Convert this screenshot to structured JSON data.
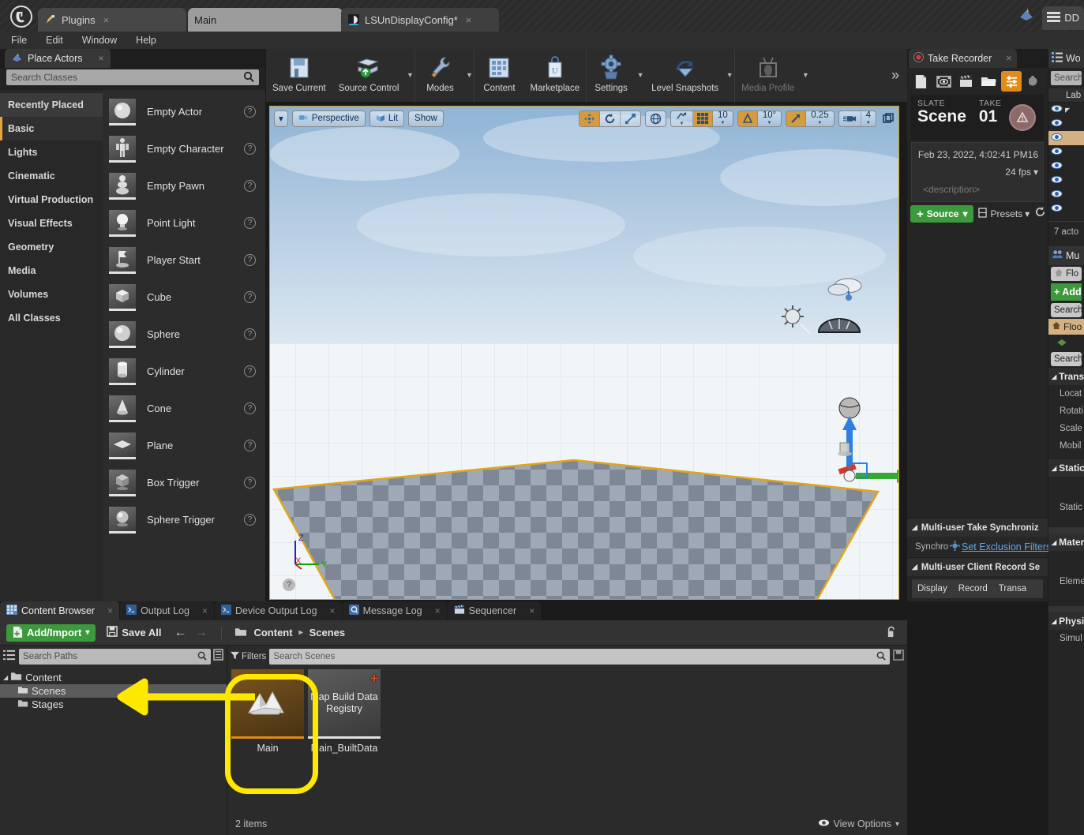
{
  "title_bar": {
    "app_icon": "unreal-logo-icon",
    "tabs": [
      {
        "label": "Plugins",
        "icon": "plug-icon",
        "close": "×"
      },
      {
        "label": "Main",
        "icon": "",
        "close": ""
      },
      {
        "label": "LSUnDisplayConfig*",
        "icon": "ndisplay-icon",
        "close": "×"
      }
    ],
    "right_tab_label": "DD"
  },
  "menu_bar": {
    "items": [
      "File",
      "Edit",
      "Window",
      "Help"
    ]
  },
  "place_actors": {
    "tab_label": "Place Actors",
    "tab_icon": "place-actors-icon",
    "close": "×",
    "search_placeholder": "Search Classes",
    "search_icon": "search-icon",
    "categories": [
      {
        "label": "Recently Placed",
        "state": "hover"
      },
      {
        "label": "Basic",
        "state": "selected"
      },
      {
        "label": "Lights",
        "state": "normal"
      },
      {
        "label": "Cinematic",
        "state": "normal"
      },
      {
        "label": "Virtual Production",
        "state": "normal"
      },
      {
        "label": "Visual Effects",
        "state": "normal"
      },
      {
        "label": "Geometry",
        "state": "normal"
      },
      {
        "label": "Media",
        "state": "normal"
      },
      {
        "label": "Volumes",
        "state": "normal"
      },
      {
        "label": "All Classes",
        "state": "normal"
      }
    ],
    "items": [
      {
        "label": "Empty Actor",
        "icon": "sphere-thumb-icon",
        "help": "?"
      },
      {
        "label": "Empty Character",
        "icon": "character-thumb-icon",
        "help": "?"
      },
      {
        "label": "Empty Pawn",
        "icon": "pawn-thumb-icon",
        "help": "?"
      },
      {
        "label": "Point Light",
        "icon": "bulb-thumb-icon",
        "help": "?"
      },
      {
        "label": "Player Start",
        "icon": "flag-thumb-icon",
        "help": "?"
      },
      {
        "label": "Cube",
        "icon": "cube-thumb-icon",
        "help": "?"
      },
      {
        "label": "Sphere",
        "icon": "sphere-thumb-icon",
        "help": "?"
      },
      {
        "label": "Cylinder",
        "icon": "cylinder-thumb-icon",
        "help": "?"
      },
      {
        "label": "Cone",
        "icon": "cone-thumb-icon",
        "help": "?"
      },
      {
        "label": "Plane",
        "icon": "plane-thumb-icon",
        "help": "?"
      },
      {
        "label": "Box Trigger",
        "icon": "box-trigger-thumb-icon",
        "help": "?"
      },
      {
        "label": "Sphere Trigger",
        "icon": "sphere-trigger-thumb-icon",
        "help": "?"
      }
    ]
  },
  "main_toolbar": {
    "tools": [
      {
        "label": "Save Current",
        "icon": "floppy-disk-icon",
        "caret": false,
        "dim": false
      },
      {
        "label": "Source Control",
        "icon": "source-control-icon",
        "caret": true,
        "dim": false
      },
      {
        "label": "Modes",
        "icon": "wrench-pencil-icon",
        "caret": true,
        "dim": false
      },
      {
        "label": "Content",
        "icon": "content-grid-icon",
        "caret": false,
        "dim": false
      },
      {
        "label": "Marketplace",
        "icon": "marketplace-bag-icon",
        "caret": false,
        "dim": false
      },
      {
        "label": "Settings",
        "icon": "gear-icon",
        "caret": true,
        "dim": false
      },
      {
        "label": "Level Snapshots",
        "icon": "level-snapshots-icon",
        "caret": true,
        "dim": false
      },
      {
        "label": "Media Profile",
        "icon": "media-profile-icon",
        "caret": true,
        "dim": true
      }
    ],
    "overflow": "»"
  },
  "viewport": {
    "dropdown_caret": "▾",
    "view_mode": "Perspective",
    "view_mode_icon": "camera-icon",
    "lighting_mode": "Lit",
    "lighting_icon": "lit-cube-icon",
    "show_menu": "Show",
    "transform_tools": [
      {
        "icon": "translate-gizmo-icon",
        "active": true
      },
      {
        "icon": "rotate-gizmo-icon",
        "active": false
      },
      {
        "icon": "scale-gizmo-icon",
        "active": false
      }
    ],
    "coordinate_system_icon": "world-globe-icon",
    "surface_snap_icon": "surface-snap-icon",
    "grid_snap_icon": "grid-snap-icon",
    "grid_snap_value": "10",
    "angle_snap_icon": "angle-snap-icon",
    "angle_snap_value": "10°",
    "scale_snap_icon": "scale-snap-icon",
    "scale_snap_value": "0.25",
    "camera_speed_icon": "camera-speed-icon",
    "camera_speed_value": "4",
    "maximize_icon": "maximize-viewport-icon",
    "axes": {
      "z": "Z",
      "x": "X",
      "y": "Y"
    },
    "help_icon": "?"
  },
  "take_recorder": {
    "tab_label": "Take Recorder",
    "tab_icon": "record-dot-icon",
    "close": "×",
    "tools": [
      {
        "icon": "new-take-icon",
        "active": false
      },
      {
        "icon": "review-take-icon",
        "active": false
      },
      {
        "icon": "clapperboard-icon",
        "active": false
      },
      {
        "icon": "open-folder-icon",
        "active": false
      },
      {
        "icon": "settings-list-icon",
        "active": true
      },
      {
        "icon": "more-settings-icon",
        "active": false
      }
    ],
    "slate_caption": "SLATE",
    "slate_value": "Scene",
    "take_caption": "TAKE",
    "take_value": "01",
    "record_icon": "record-warning-icon",
    "timestamp": "Feb 23, 2022, 4:02:41 PM",
    "timestamp_extra": "16",
    "frame_rate": "24 fps",
    "frame_rate_caret": "▾",
    "description_placeholder": "<description>",
    "source_button": "Source",
    "source_plus": "+",
    "source_caret": "▾",
    "presets_button": "Presets",
    "presets_icon": "presets-icon",
    "presets_caret": "▾",
    "reset_icon": "reset-arrow-icon",
    "sections": [
      {
        "label": "Multi-user Take Synchroniz",
        "arrow": "◢"
      },
      {
        "label": "Multi-user Client Record Se",
        "arrow": "◢"
      }
    ],
    "sync_label": "Synchro",
    "exclusion_filters_link": "Set Exclusion Filters",
    "exclusion_icon": "gear-small-icon",
    "record_tabs": [
      "Display",
      "Record",
      "Transa"
    ]
  },
  "far_right": {
    "outliner_tab": "Wo",
    "outliner_icon": "outliner-list-icon",
    "search_placeholder": "Search",
    "column_header": "Lab",
    "rows": [
      {
        "eye": "eye-icon",
        "selected": false
      },
      {
        "eye": "eye-icon",
        "selected": false
      },
      {
        "eye": "eye-icon",
        "selected": true
      },
      {
        "eye": "eye-icon",
        "selected": false
      },
      {
        "eye": "eye-icon",
        "selected": false
      },
      {
        "eye": "eye-icon",
        "selected": false
      },
      {
        "eye": "eye-icon",
        "selected": false
      },
      {
        "eye": "eye-icon",
        "selected": false
      }
    ],
    "actor_count": "7 acto",
    "multiuser_tab": "Mu",
    "multiuser_icon": "multiuser-icon",
    "details_name": "Flo",
    "details_icon": "house-icon",
    "add_button": "+ Add",
    "details_search": "Search",
    "selected_actor": "Floo",
    "selected_actor_icon": "house-icon",
    "component_icon": "mesh-icon",
    "prop_search": "Search",
    "sections": [
      {
        "label": "Trans",
        "arrow": "◢"
      },
      {
        "label": "Static",
        "arrow": "◢"
      },
      {
        "label": "Mater",
        "arrow": "◢"
      },
      {
        "label": "Physi",
        "arrow": "◢"
      }
    ],
    "transform_props": [
      "Locat",
      "Rotati",
      "Scale",
      "Mobil"
    ],
    "static_prop": "Static",
    "material_prop": "Eleme",
    "physics_prop": "Simul"
  },
  "content_browser": {
    "tabs": [
      {
        "label": "Content Browser",
        "icon": "content-browser-icon",
        "active": true,
        "close": "×"
      },
      {
        "label": "Output Log",
        "icon": "output-log-icon",
        "active": false,
        "close": "×"
      },
      {
        "label": "Device Output Log",
        "icon": "device-log-icon",
        "active": false,
        "close": "×"
      },
      {
        "label": "Message Log",
        "icon": "message-log-icon",
        "active": false,
        "close": "×"
      },
      {
        "label": "Sequencer",
        "icon": "sequencer-icon",
        "active": false,
        "close": "×"
      }
    ],
    "add_import": "Add/Import",
    "add_import_caret": "▾",
    "add_import_icon": "document-plus-icon",
    "save_all": "Save All",
    "save_all_icon": "save-icon",
    "back_icon": "arrow-left-icon",
    "forward_icon": "arrow-right-icon",
    "breadcrumb_icon": "folder-icon",
    "breadcrumb": [
      "Content",
      "Scenes"
    ],
    "breadcrumb_sep": "▸",
    "lock_icon": "lock-open-icon",
    "paths_search_placeholder": "Search Paths",
    "paths_search_icon": "search-icon",
    "paths_tree_icon": "tree-toggle-icon",
    "paths_list_icon": "list-view-icon",
    "tree": [
      {
        "label": "Content",
        "depth": 0,
        "expanded": true,
        "selected": false,
        "icon": "folder-icon"
      },
      {
        "label": "Scenes",
        "depth": 1,
        "expanded": false,
        "selected": true,
        "icon": "folder-icon"
      },
      {
        "label": "Stages",
        "depth": 1,
        "expanded": false,
        "selected": false,
        "icon": "folder-icon"
      }
    ],
    "filters_label": "Filters",
    "filters_icon": "filter-icon",
    "asset_search_placeholder": "Search Scenes",
    "asset_search_icon": "search-icon",
    "asset_save_icon": "save-small-icon",
    "assets": [
      {
        "name": "Main",
        "thumb_label": "",
        "selected": true,
        "badge": "+",
        "icon": "level-map-icon"
      },
      {
        "name": "Main_BuiltData",
        "thumb_label": "Map Build Data Registry",
        "selected": false,
        "badge": "+",
        "icon": "map-build-data-icon"
      }
    ],
    "item_count": "2 items",
    "view_options": "View Options",
    "view_options_icon": "eye-icon",
    "view_options_caret": "▾"
  },
  "annotations": {
    "highlight_color": "#ffe800",
    "arrow_name": "scenes-folder-pointer-arrow",
    "ring_name": "main-asset-highlight-ring"
  }
}
